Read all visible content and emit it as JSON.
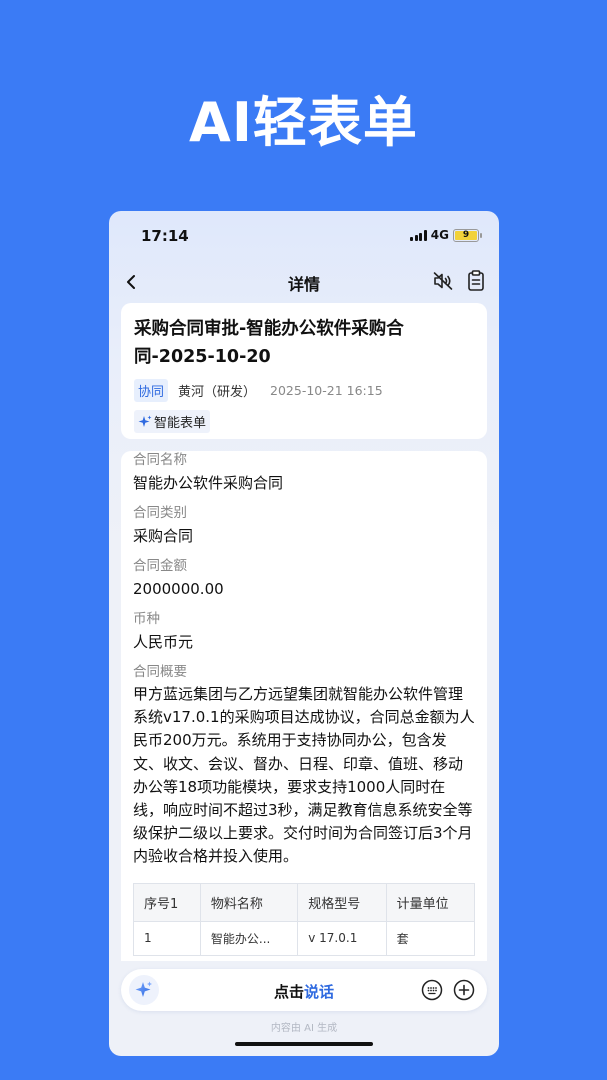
{
  "promo": {
    "title": "AI轻表单"
  },
  "status_bar": {
    "time": "17:14",
    "network": "4G",
    "battery": "9"
  },
  "nav": {
    "title": "详情",
    "icons": [
      "back-icon",
      "mute-icon",
      "clipboard-icon"
    ]
  },
  "header_card": {
    "title": "采购合同审批-智能办公软件采购合同-2025-10-20",
    "tag": "协同",
    "author": "黄河（研发）",
    "time": "2025-10-21 16:15",
    "badge": "智能表单"
  },
  "fields": [
    {
      "label": "合同名称",
      "value": "智能办公软件采购合同"
    },
    {
      "label": "合同类别",
      "value": "采购合同"
    },
    {
      "label": "合同金额",
      "value": "2000000.00"
    },
    {
      "label": "币种",
      "value": "人民币元"
    }
  ],
  "summary": {
    "label": "合同概要",
    "text": "甲方蓝远集团与乙方远望集团就智能办公软件管理系统v17.0.1的采购项目达成协议，合同总金额为人民币200万元。系统用于支持协同办公，包含发文、收文、会议、督办、日程、印章、值班、移动办公等18项功能模块，要求支持1000人同时在线，响应时间不超过3秒，满足教育信息系统安全等级保护二级以上要求。交付时间为合同签订后3个月内验收合格并投入使用。"
  },
  "table": {
    "headers": [
      "序号1",
      "物料名称",
      "规格型号",
      "计量单位"
    ],
    "rows": [
      [
        "1",
        "智能办公...",
        "v 17.0.1",
        "套"
      ]
    ]
  },
  "bottom_bar": {
    "voice_prefix": "点击",
    "voice_accent": "说话",
    "footnote": "内容由 AI 生成"
  },
  "colors": {
    "background": "#3b7bf5",
    "accent": "#2f6ae0",
    "card": "#ffffff"
  }
}
